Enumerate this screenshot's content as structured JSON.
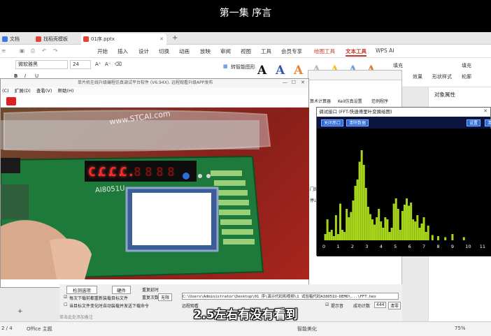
{
  "video": {
    "title": "第一集 序言",
    "subtitle": "2.5左右有没有看到"
  },
  "browser": {
    "tabs": [
      {
        "label": "文档",
        "color": "#3a7be0"
      },
      {
        "label": "找稻壳模板",
        "color": "#e0443a"
      },
      {
        "label": "01序.pptx",
        "color": "#e0443a"
      }
    ],
    "new_tab": "+"
  },
  "wps": {
    "menu": [
      "开始",
      "插入",
      "设计",
      "切换",
      "动画",
      "放映",
      "审阅",
      "视图",
      "工具",
      "会员专享",
      "绘图工具",
      "文本工具",
      "WPS AI"
    ],
    "font_name": "微软雅黑",
    "font_size": "24",
    "ribbon": {
      "convert": "转智能图形",
      "fill": "填充",
      "outline": "轮廓",
      "effect": "效果",
      "shape_style": "形状样式",
      "object_props": "对象属性"
    },
    "art_letter": "A"
  },
  "cam_window": {
    "title": "单片机在线升级编程仿真调试平台软件 (V6.94X), 远程观看升级APP发布",
    "menu": [
      "(C)",
      "扩展(D)",
      "查看(V)",
      "帮助(H)"
    ],
    "board_text": "AI8051U",
    "lid_text": "www.STCAI.com",
    "display_digits": [
      "C.",
      "C.",
      "C.",
      "C.",
      "8",
      "8",
      "8",
      "8"
    ]
  },
  "keil": {
    "tabs": [
      "算术计算器",
      "Keil仿真设置",
      "范例程序"
    ],
    "side_labels": [
      "门的",
      "停止"
    ]
  },
  "fft_window": {
    "title": "调试接口 (FFT-快速傅里叶变换绘图)",
    "buttons": [
      "关闭串口",
      "清除数据",
      "设置",
      "清"
    ],
    "x_ticks": [
      "0",
      "1",
      "2",
      "3",
      "4",
      "5",
      "6",
      "7",
      "8",
      "9",
      "10",
      "11"
    ]
  },
  "chart_data": {
    "type": "bar",
    "x_range": [
      0,
      11.5
    ],
    "y_range": [
      0,
      1
    ],
    "bar_color": "#a6d51b",
    "values": [
      {
        "x": 0.1,
        "y": 0.06
      },
      {
        "x": 0.25,
        "y": 0.2
      },
      {
        "x": 0.4,
        "y": 0.08
      },
      {
        "x": 0.55,
        "y": 0.1
      },
      {
        "x": 0.7,
        "y": 0.04
      },
      {
        "x": 0.85,
        "y": 0.24
      },
      {
        "x": 1.0,
        "y": 0.06
      },
      {
        "x": 1.15,
        "y": 0.35
      },
      {
        "x": 1.3,
        "y": 0.1
      },
      {
        "x": 1.45,
        "y": 0.08
      },
      {
        "x": 1.6,
        "y": 0.3
      },
      {
        "x": 1.75,
        "y": 0.22
      },
      {
        "x": 1.9,
        "y": 0.27
      },
      {
        "x": 2.05,
        "y": 0.38
      },
      {
        "x": 2.2,
        "y": 0.52
      },
      {
        "x": 2.35,
        "y": 0.58
      },
      {
        "x": 2.5,
        "y": 0.75
      },
      {
        "x": 2.65,
        "y": 0.86
      },
      {
        "x": 2.8,
        "y": 0.72
      },
      {
        "x": 2.95,
        "y": 0.5
      },
      {
        "x": 3.1,
        "y": 0.32
      },
      {
        "x": 3.25,
        "y": 0.25
      },
      {
        "x": 3.4,
        "y": 0.2
      },
      {
        "x": 3.55,
        "y": 0.15
      },
      {
        "x": 3.7,
        "y": 0.22
      },
      {
        "x": 3.85,
        "y": 0.3
      },
      {
        "x": 4.0,
        "y": 0.18
      },
      {
        "x": 4.15,
        "y": 0.12
      },
      {
        "x": 4.3,
        "y": 0.22
      },
      {
        "x": 4.45,
        "y": 0.2
      },
      {
        "x": 4.6,
        "y": 0.08
      },
      {
        "x": 4.75,
        "y": 0.12
      },
      {
        "x": 4.9,
        "y": 0.35
      },
      {
        "x": 5.05,
        "y": 0.4
      },
      {
        "x": 5.2,
        "y": 0.3
      },
      {
        "x": 5.35,
        "y": 0.1
      },
      {
        "x": 5.5,
        "y": 0.28
      },
      {
        "x": 5.65,
        "y": 0.34
      },
      {
        "x": 5.8,
        "y": 0.4
      },
      {
        "x": 5.95,
        "y": 0.33
      },
      {
        "x": 6.1,
        "y": 0.36
      },
      {
        "x": 6.25,
        "y": 0.2
      },
      {
        "x": 6.4,
        "y": 0.18
      },
      {
        "x": 6.55,
        "y": 0.24
      },
      {
        "x": 6.7,
        "y": 0.12
      },
      {
        "x": 6.85,
        "y": 0.16
      },
      {
        "x": 7.0,
        "y": 0.22
      },
      {
        "x": 7.15,
        "y": 0.08
      },
      {
        "x": 7.3,
        "y": 0.14
      },
      {
        "x": 7.6,
        "y": 0.05
      },
      {
        "x": 8.0,
        "y": 0.04
      },
      {
        "x": 8.5,
        "y": 0.03
      },
      {
        "x": 9.0,
        "y": 0.06
      },
      {
        "x": 9.8,
        "y": 0.03
      }
    ]
  },
  "settings": {
    "check_options": "检测选项",
    "hardware": "硬件",
    "retry_label": "重复延时",
    "retry_count_label": "重复次数",
    "retry_count_value": "无限",
    "reload_option": "每次下载前都重新装载目标文件",
    "auto_send_option": "当目标文件变化时自动装载并发送下载命令",
    "path": "C:\\Users\\Administrator\\Desktop\\01 序\\演示代码和视频\\1 试验箱代码AI8051U-DEMO\\...\\FFT.hex",
    "program_label": "远程观看",
    "hint_label": "提示音",
    "success_label": "成功计数",
    "success_count": "444",
    "clear_btn": "清零"
  },
  "status": {
    "page": "2 / 4",
    "theme": "Office 主题",
    "notes": "单击此处添加备注",
    "beautify": "智能美化",
    "zoom": "75%"
  }
}
